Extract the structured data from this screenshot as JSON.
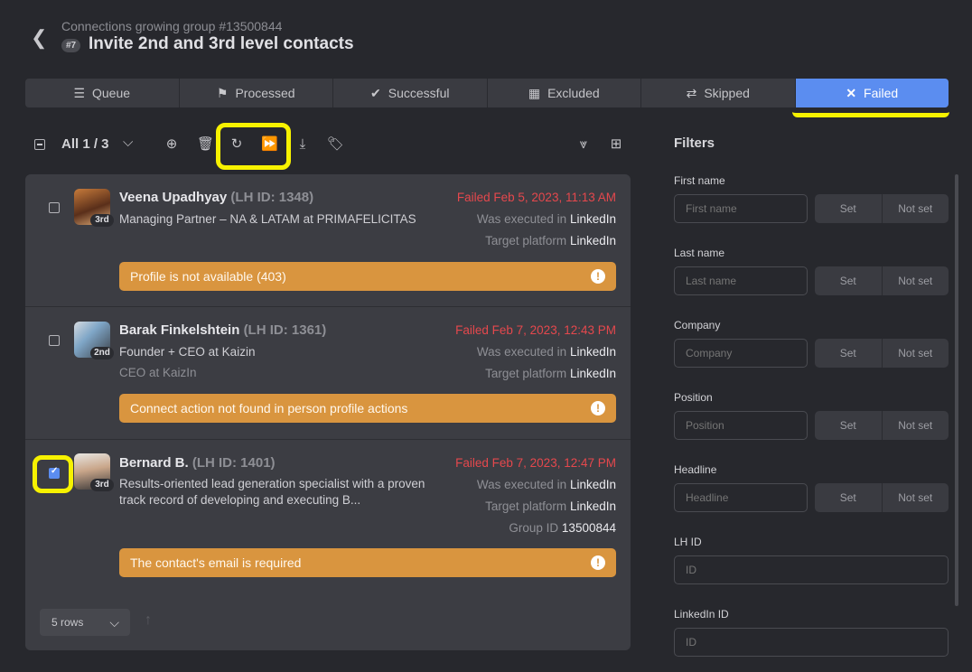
{
  "header": {
    "subtitle": "Connections growing group #13500844",
    "badge": "#7",
    "title": "Invite 2nd and 3rd level contacts",
    "back_icon": "chevron-left-icon"
  },
  "tabs": [
    {
      "label": "Queue",
      "icon": "queue-icon"
    },
    {
      "label": "Processed",
      "icon": "flag-icon"
    },
    {
      "label": "Successful",
      "icon": "check-icon"
    },
    {
      "label": "Excluded",
      "icon": "excluded-icon"
    },
    {
      "label": "Skipped",
      "icon": "skip-icon"
    },
    {
      "label": "Failed",
      "icon": "x-icon",
      "active": true
    }
  ],
  "toolbar": {
    "selection": "All 1 / 3",
    "icons": [
      "add-note-icon",
      "trash-icon",
      "retry-icon",
      "fast-forward-icon",
      "download-icon",
      "tag-icon",
      "hide-icon",
      "grid-icon"
    ]
  },
  "contacts": [
    {
      "name": "Veena Upadhyay",
      "lhid": "(LH ID: 1348)",
      "degree": "3rd",
      "headline": "Managing Partner – NA & LATAM at PRIMAFELICITAS",
      "company": "",
      "status": "Failed Feb 5, 2023, 11:13 AM",
      "executed_label": "Was executed in",
      "executed_value": "LinkedIn",
      "target_label": "Target platform",
      "target_value": "LinkedIn",
      "group_label": "",
      "group_value": "",
      "error": "Profile is not available (403)",
      "checked": false
    },
    {
      "name": "Barak Finkelshtein",
      "lhid": "(LH ID: 1361)",
      "degree": "2nd",
      "headline": "Founder + CEO at Kaizin",
      "company": "CEO at KaizIn",
      "status": "Failed Feb 7, 2023, 12:43 PM",
      "executed_label": "Was executed in",
      "executed_value": "LinkedIn",
      "target_label": "Target platform",
      "target_value": "LinkedIn",
      "group_label": "",
      "group_value": "",
      "error": "Connect action not found in person profile actions",
      "checked": false
    },
    {
      "name": "Bernard B.",
      "lhid": "(LH ID: 1401)",
      "degree": "3rd",
      "headline": "Results-oriented lead generation specialist with a proven track record of developing and executing B...",
      "company": "",
      "status": "Failed Feb 7, 2023, 12:47 PM",
      "executed_label": "Was executed in",
      "executed_value": "LinkedIn",
      "target_label": "Target platform",
      "target_value": "LinkedIn",
      "group_label": "Group ID",
      "group_value": "13500844",
      "error": "The contact's email is required",
      "checked": true
    }
  ],
  "footer": {
    "rows_label": "5 rows"
  },
  "filters": {
    "title": "Filters",
    "set_label": "Set",
    "notset_label": "Not set",
    "fields": [
      {
        "label": "First name",
        "placeholder": "First name"
      },
      {
        "label": "Last name",
        "placeholder": "Last name"
      },
      {
        "label": "Company",
        "placeholder": "Company"
      },
      {
        "label": "Position",
        "placeholder": "Position"
      },
      {
        "label": "Headline",
        "placeholder": "Headline"
      },
      {
        "label": "LH ID",
        "placeholder": "ID"
      },
      {
        "label": "LinkedIn ID",
        "placeholder": "ID"
      }
    ]
  },
  "colors": {
    "accent": "#5b8df0",
    "failed": "#e5484d",
    "error_banner": "#d9953f",
    "highlight": "#f7f200"
  }
}
